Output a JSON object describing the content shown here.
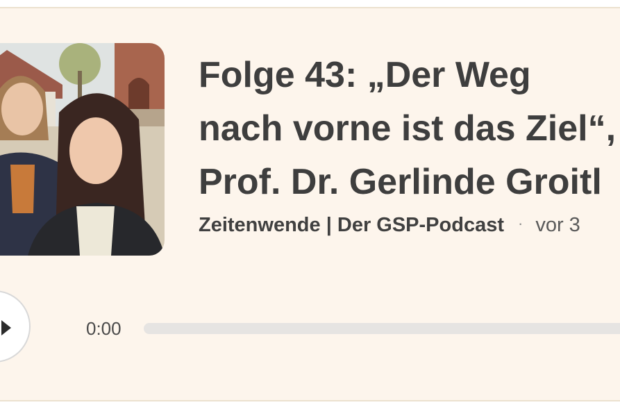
{
  "episode": {
    "title_lines": [
      "Folge 43: „Der Weg",
      "nach vorne ist das Ziel“,",
      "Prof. Dr. Gerlinde Groitl"
    ],
    "podcast": "Zeitenwende | Der GSP-Podcast",
    "separator": "·",
    "date": "vor 3",
    "cover_icon": "podcast-cover-photo"
  },
  "player": {
    "current_time": "0:00",
    "progress": 0,
    "play_icon": "play-icon"
  },
  "colors": {
    "card_background": "#fdf5ec",
    "title": "#3e3e3e",
    "track": "#e6e4e2"
  }
}
